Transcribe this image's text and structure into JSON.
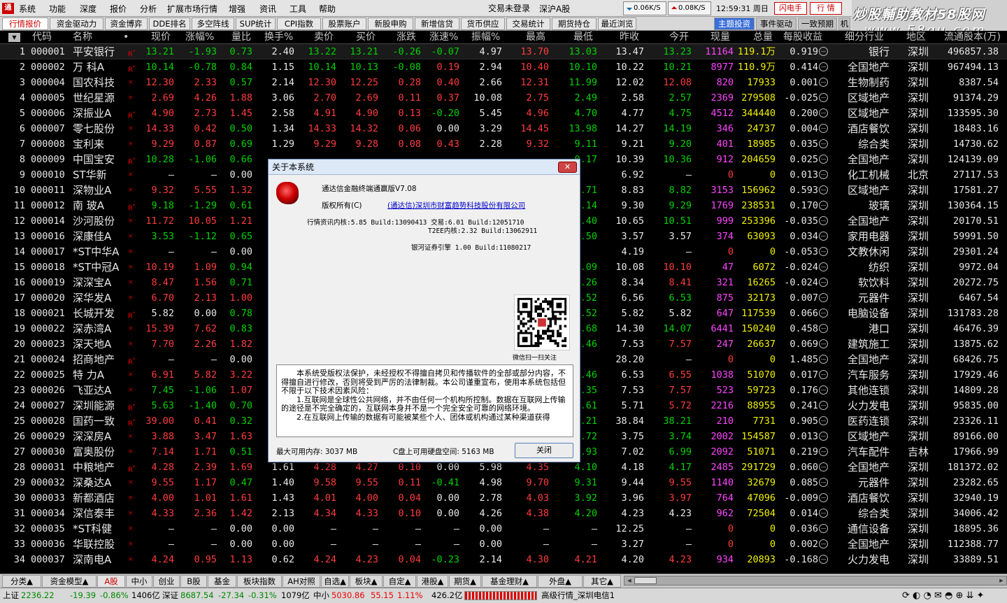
{
  "app": {
    "logo_label": "通",
    "menu": [
      "系统",
      "功能",
      "深度",
      "报价",
      "分析",
      "扩展市场行情",
      "增强",
      "资讯",
      "工具",
      "帮助"
    ],
    "status": {
      "login": "交易未登录",
      "market": "深沪A股"
    },
    "speed_down": "0.06K/S",
    "speed_up": "0.08K/S",
    "clock": "12:59:31 周日",
    "btn_flash": "闪电手",
    "btn_trade": "行 情",
    "watermark_line1": "炒股輔助教材58股网",
    "watermark_line2": "www.58gu.com"
  },
  "tabs": [
    "行情报价",
    "资金驱动力",
    "资金博弈",
    "DDE排名",
    "多空阵线",
    "SUP统计",
    "CPI指数",
    "股票账户",
    "新股申购",
    "新增信贷",
    "货币供应",
    "交易统计",
    "期货持仓",
    "最近浏览"
  ],
  "tabs_right": [
    "主题投资",
    "事件驱动",
    "一致预期",
    "机"
  ],
  "columns": [
    "代码",
    "名称",
    "•",
    "现价",
    "涨幅%",
    "量比",
    "换手%",
    "卖价",
    "买价",
    "涨跌",
    "涨速%",
    "振幅%",
    "最高",
    "最低",
    "昨收",
    "今开",
    "现量",
    "总量",
    "每股收益",
    "细分行业",
    "地区",
    "流通股本(万)"
  ],
  "rows": [
    {
      "n": "1",
      "code": "000001",
      "name": "平安银行",
      "mk": "R",
      "pr": "13.21",
      "chg": "-1.93",
      "vr": "0.73",
      "to": "2.40",
      "ask": "13.22",
      "bid": "13.21",
      "dif": "-0.26",
      "spd": "-0.07",
      "amp": "4.97",
      "hi": "13.70",
      "lo": "13.03",
      "pc": "13.47",
      "op": "13.23",
      "cv": "11164",
      "tv": "119.1万",
      "eps": "0.919",
      "ind": "银行",
      "reg": "深圳",
      "fl": "496857.38"
    },
    {
      "n": "2",
      "code": "000002",
      "name": "万 科A",
      "mk": "R",
      "pr": "10.14",
      "chg": "-0.78",
      "vr": "0.84",
      "to": "1.15",
      "ask": "10.14",
      "bid": "10.13",
      "dif": "-0.08",
      "spd": "0.19",
      "amp": "2.94",
      "hi": "10.40",
      "lo": "10.10",
      "pc": "10.22",
      "op": "10.21",
      "cv": "8977",
      "tv": "110.9万",
      "eps": "0.414",
      "ind": "全国地产",
      "reg": "深圳",
      "fl": "967494.13"
    },
    {
      "n": "3",
      "code": "000004",
      "name": "国农科技",
      "mk": "",
      "pr": "12.30",
      "chg": "2.33",
      "vr": "0.57",
      "to": "2.14",
      "ask": "12.30",
      "bid": "12.25",
      "dif": "0.28",
      "spd": "0.40",
      "amp": "2.66",
      "hi": "12.31",
      "lo": "11.99",
      "pc": "12.02",
      "op": "12.08",
      "cv": "820",
      "tv": "17933",
      "eps": "0.001",
      "ind": "生物制药",
      "reg": "深圳",
      "fl": "8387.54"
    },
    {
      "n": "4",
      "code": "000005",
      "name": "世纪星源",
      "mk": "",
      "pr": "2.69",
      "chg": "4.26",
      "vr": "1.88",
      "to": "3.06",
      "ask": "2.70",
      "bid": "2.69",
      "dif": "0.11",
      "spd": "0.37",
      "amp": "10.08",
      "hi": "2.75",
      "lo": "2.49",
      "pc": "2.58",
      "op": "2.57",
      "cv": "2369",
      "tv": "279508",
      "eps": "-0.025",
      "ind": "区域地产",
      "reg": "深圳",
      "fl": "91374.29"
    },
    {
      "n": "5",
      "code": "000006",
      "name": "深振业A",
      "mk": "R",
      "pr": "4.90",
      "chg": "2.73",
      "vr": "1.45",
      "to": "2.58",
      "ask": "4.91",
      "bid": "4.90",
      "dif": "0.13",
      "spd": "-0.20",
      "amp": "5.45",
      "hi": "4.96",
      "lo": "4.70",
      "pc": "4.77",
      "op": "4.75",
      "cv": "4512",
      "tv": "344440",
      "eps": "0.200",
      "ind": "区域地产",
      "reg": "深圳",
      "fl": "133595.30"
    },
    {
      "n": "6",
      "code": "000007",
      "name": "零七股份",
      "mk": "",
      "pr": "14.33",
      "chg": "0.42",
      "vr": "0.50",
      "to": "1.34",
      "ask": "14.33",
      "bid": "14.32",
      "dif": "0.06",
      "spd": "0.00",
      "amp": "3.29",
      "hi": "14.45",
      "lo": "13.98",
      "pc": "14.27",
      "op": "14.19",
      "cv": "346",
      "tv": "24737",
      "eps": "0.004",
      "ind": "酒店餐饮",
      "reg": "深圳",
      "fl": "18483.16"
    },
    {
      "n": "7",
      "code": "000008",
      "name": "宝利来",
      "mk": "",
      "pr": "9.29",
      "chg": "0.87",
      "vr": "0.69",
      "to": "1.29",
      "ask": "9.29",
      "bid": "9.28",
      "dif": "0.08",
      "spd": "0.43",
      "amp": "2.28",
      "hi": "9.32",
      "lo": "9.11",
      "pc": "9.21",
      "op": "9.20",
      "cv": "401",
      "tv": "18985",
      "eps": "0.035",
      "ind": "综合类",
      "reg": "深圳",
      "fl": "14730.62"
    },
    {
      "n": "8",
      "code": "000009",
      "name": "中国宝安",
      "mk": "R",
      "pr": "10.28",
      "chg": "-1.06",
      "vr": "0.66",
      "to": "",
      "ask": "",
      "bid": "",
      "dif": "",
      "spd": "",
      "amp": "",
      "hi": "",
      "lo": "0.17",
      "pc": "10.39",
      "op": "10.36",
      "cv": "912",
      "tv": "204659",
      "eps": "0.025",
      "ind": "全国地产",
      "reg": "深圳",
      "fl": "124139.09"
    },
    {
      "n": "9",
      "code": "000010",
      "name": "ST华新",
      "mk": "",
      "pr": "—",
      "chg": "—",
      "vr": "0.00",
      "to": "",
      "ask": "",
      "bid": "",
      "dif": "",
      "spd": "",
      "amp": "",
      "hi": "",
      "lo": "",
      "pc": "6.92",
      "op": "—",
      "cv": "0",
      "tv": "0",
      "eps": "0.013",
      "ind": "化工机械",
      "reg": "北京",
      "fl": "27117.53"
    },
    {
      "n": "10",
      "code": "000011",
      "name": "深物业A",
      "mk": "",
      "pr": "9.32",
      "chg": "5.55",
      "vr": "1.32",
      "to": "",
      "ask": "",
      "bid": "",
      "dif": "",
      "spd": "",
      "amp": "",
      "hi": "",
      "lo": ".71",
      "pc": "8.83",
      "op": "8.82",
      "cv": "3153",
      "tv": "156962",
      "eps": "0.593",
      "ind": "区域地产",
      "reg": "深圳",
      "fl": "17581.27"
    },
    {
      "n": "11",
      "code": "000012",
      "name": "南 玻A",
      "mk": "R",
      "pr": "9.18",
      "chg": "-1.29",
      "vr": "0.61",
      "to": "",
      "ask": "",
      "bid": "",
      "dif": "",
      "spd": "",
      "amp": "",
      "hi": "",
      "lo": ".14",
      "pc": "9.30",
      "op": "9.29",
      "cv": "1769",
      "tv": "238531",
      "eps": "0.170",
      "ind": "玻璃",
      "reg": "深圳",
      "fl": "130364.15"
    },
    {
      "n": "12",
      "code": "000014",
      "name": "沙河股份",
      "mk": "",
      "pr": "11.72",
      "chg": "10.05",
      "vr": "1.21",
      "to": "",
      "ask": "",
      "bid": "",
      "dif": "",
      "spd": "",
      "amp": "",
      "hi": "",
      "lo": ".40",
      "pc": "10.65",
      "op": "10.51",
      "cv": "999",
      "tv": "253396",
      "eps": "-0.035",
      "ind": "全国地产",
      "reg": "深圳",
      "fl": "20170.51"
    },
    {
      "n": "13",
      "code": "000016",
      "name": "深康佳A",
      "mk": "",
      "pr": "3.53",
      "chg": "-1.12",
      "vr": "0.65",
      "to": "",
      "ask": "",
      "bid": "",
      "dif": "",
      "spd": "",
      "amp": "",
      "hi": "",
      "lo": ".50",
      "pc": "3.57",
      "op": "3.57",
      "cv": "374",
      "tv": "63093",
      "eps": "0.034",
      "ind": "家用电器",
      "reg": "深圳",
      "fl": "59991.50"
    },
    {
      "n": "14",
      "code": "000017",
      "name": "*ST中华A",
      "mk": "",
      "pr": "—",
      "chg": "—",
      "vr": "0.00",
      "to": "",
      "ask": "",
      "bid": "",
      "dif": "",
      "spd": "",
      "amp": "",
      "hi": "",
      "lo": "",
      "pc": "4.19",
      "op": "—",
      "cv": "0",
      "tv": "0",
      "eps": "-0.053",
      "ind": "文教休闲",
      "reg": "深圳",
      "fl": "29301.24"
    },
    {
      "n": "15",
      "code": "000018",
      "name": "*ST中冠A",
      "mk": "",
      "pr": "10.19",
      "chg": "1.09",
      "vr": "0.94",
      "to": "",
      "ask": "",
      "bid": "",
      "dif": "",
      "spd": "",
      "amp": "",
      "hi": "",
      "lo": ".09",
      "pc": "10.08",
      "op": "10.10",
      "cv": "47",
      "tv": "6072",
      "eps": "-0.024",
      "ind": "纺织",
      "reg": "深圳",
      "fl": "9972.04"
    },
    {
      "n": "16",
      "code": "000019",
      "name": "深深宝A",
      "mk": "",
      "pr": "8.47",
      "chg": "1.56",
      "vr": "0.71",
      "to": "",
      "ask": "",
      "bid": "",
      "dif": "",
      "spd": "",
      "amp": "",
      "hi": "",
      "lo": ".26",
      "pc": "8.34",
      "op": "8.41",
      "cv": "321",
      "tv": "16265",
      "eps": "-0.024",
      "ind": "软饮料",
      "reg": "深圳",
      "fl": "20272.75"
    },
    {
      "n": "17",
      "code": "000020",
      "name": "深华发A",
      "mk": "",
      "pr": "6.70",
      "chg": "2.13",
      "vr": "1.00",
      "to": "",
      "ask": "",
      "bid": "",
      "dif": "",
      "spd": "",
      "amp": "",
      "hi": "",
      "lo": ".52",
      "pc": "6.56",
      "op": "6.53",
      "cv": "875",
      "tv": "32173",
      "eps": "0.007",
      "ind": "元器件",
      "reg": "深圳",
      "fl": "6467.54"
    },
    {
      "n": "18",
      "code": "000021",
      "name": "长城开发",
      "mk": "R",
      "pr": "5.82",
      "chg": "0.00",
      "vr": "0.78",
      "to": "",
      "ask": "",
      "bid": "",
      "dif": "",
      "spd": "",
      "amp": "",
      "hi": "",
      "lo": ".52",
      "pc": "5.82",
      "op": "5.82",
      "cv": "647",
      "tv": "117539",
      "eps": "0.066",
      "ind": "电脑设备",
      "reg": "深圳",
      "fl": "131783.28"
    },
    {
      "n": "19",
      "code": "000022",
      "name": "深赤湾A",
      "mk": "",
      "pr": "15.39",
      "chg": "7.62",
      "vr": "0.83",
      "to": "",
      "ask": "",
      "bid": "",
      "dif": "",
      "spd": "",
      "amp": "",
      "hi": "",
      "lo": ".68",
      "pc": "14.30",
      "op": "14.07",
      "cv": "6441",
      "tv": "150240",
      "eps": "0.458",
      "ind": "港口",
      "reg": "深圳",
      "fl": "46476.39"
    },
    {
      "n": "20",
      "code": "000023",
      "name": "深天地A",
      "mk": "",
      "pr": "7.70",
      "chg": "2.26",
      "vr": "1.82",
      "to": "",
      "ask": "",
      "bid": "",
      "dif": "",
      "spd": "",
      "amp": "",
      "hi": "",
      "lo": ".46",
      "pc": "7.53",
      "op": "7.57",
      "cv": "247",
      "tv": "26637",
      "eps": "0.069",
      "ind": "建筑施工",
      "reg": "深圳",
      "fl": "13875.62"
    },
    {
      "n": "21",
      "code": "000024",
      "name": "招商地产",
      "mk": "R",
      "pr": "—",
      "chg": "—",
      "vr": "0.00",
      "to": "",
      "ask": "",
      "bid": "",
      "dif": "",
      "spd": "",
      "amp": "",
      "hi": "",
      "lo": "",
      "pc": "28.20",
      "op": "—",
      "cv": "0",
      "tv": "0",
      "eps": "1.485",
      "ind": "全国地产",
      "reg": "深圳",
      "fl": "68426.75"
    },
    {
      "n": "22",
      "code": "000025",
      "name": "特 力A",
      "mk": "",
      "pr": "6.91",
      "chg": "5.82",
      "vr": "3.22",
      "to": "",
      "ask": "",
      "bid": "",
      "dif": "",
      "spd": "",
      "amp": "",
      "hi": "",
      "lo": ".46",
      "pc": "6.53",
      "op": "6.55",
      "cv": "1038",
      "tv": "51070",
      "eps": "0.017",
      "ind": "汽车服务",
      "reg": "深圳",
      "fl": "17929.46"
    },
    {
      "n": "23",
      "code": "000026",
      "name": "飞亚达A",
      "mk": "",
      "pr": "7.45",
      "chg": "-1.06",
      "vr": "1.07",
      "to": "",
      "ask": "",
      "bid": "",
      "dif": "",
      "spd": "",
      "amp": "",
      "hi": "",
      "lo": ".35",
      "pc": "7.53",
      "op": "7.57",
      "cv": "523",
      "tv": "59723",
      "eps": "0.176",
      "ind": "其他连锁",
      "reg": "深圳",
      "fl": "14809.28"
    },
    {
      "n": "24",
      "code": "000027",
      "name": "深圳能源",
      "mk": "R",
      "pr": "5.63",
      "chg": "-1.40",
      "vr": "0.70",
      "to": "",
      "ask": "",
      "bid": "",
      "dif": "",
      "spd": "",
      "amp": "",
      "hi": "",
      "lo": ".61",
      "pc": "5.71",
      "op": "5.72",
      "cv": "2216",
      "tv": "88955",
      "eps": "0.241",
      "ind": "火力发电",
      "reg": "深圳",
      "fl": "95835.00"
    },
    {
      "n": "25",
      "code": "000028",
      "name": "国药一致",
      "mk": "R",
      "pr": "39.00",
      "chg": "0.41",
      "vr": "0.32",
      "to": "",
      "ask": "",
      "bid": "",
      "dif": "",
      "spd": "",
      "amp": "",
      "hi": "",
      "lo": ".21",
      "pc": "38.84",
      "op": "38.21",
      "cv": "210",
      "tv": "7731",
      "eps": "0.905",
      "ind": "医药连锁",
      "reg": "深圳",
      "fl": "23326.11"
    },
    {
      "n": "26",
      "code": "000029",
      "name": "深深房A",
      "mk": "",
      "pr": "3.88",
      "chg": "3.47",
      "vr": "1.63",
      "to": "",
      "ask": "",
      "bid": "",
      "dif": "",
      "spd": "",
      "amp": "",
      "hi": "",
      "lo": ".72",
      "pc": "3.75",
      "op": "3.74",
      "cv": "2002",
      "tv": "154587",
      "eps": "0.013",
      "ind": "区域地产",
      "reg": "深圳",
      "fl": "89166.00"
    },
    {
      "n": "27",
      "code": "000030",
      "name": "富奥股份",
      "mk": "",
      "pr": "7.14",
      "chg": "1.71",
      "vr": "0.51",
      "to": "",
      "ask": "",
      "bid": "",
      "dif": "",
      "spd": "",
      "amp": "",
      "hi": "",
      "lo": ".93",
      "pc": "7.02",
      "op": "6.99",
      "cv": "2092",
      "tv": "51071",
      "eps": "0.219",
      "ind": "汽车配件",
      "reg": "吉林",
      "fl": "17966.99"
    },
    {
      "n": "28",
      "code": "000031",
      "name": "中粮地产",
      "mk": "R",
      "pr": "4.28",
      "chg": "2.39",
      "vr": "1.69",
      "to": "1.61",
      "ask": "4.28",
      "bid": "4.27",
      "dif": "0.10",
      "spd": "0.00",
      "amp": "5.98",
      "hi": "4.35",
      "lo": "4.10",
      "pc": "4.18",
      "op": "4.17",
      "cv": "2485",
      "tv": "291729",
      "eps": "0.060",
      "ind": "全国地产",
      "reg": "深圳",
      "fl": "181372.02"
    },
    {
      "n": "29",
      "code": "000032",
      "name": "深桑达A",
      "mk": "",
      "pr": "9.55",
      "chg": "1.17",
      "vr": "0.47",
      "to": "1.40",
      "ask": "9.58",
      "bid": "9.55",
      "dif": "0.11",
      "spd": "-0.41",
      "amp": "4.98",
      "hi": "9.70",
      "lo": "9.31",
      "pc": "9.44",
      "op": "9.55",
      "cv": "1140",
      "tv": "32679",
      "eps": "0.085",
      "ind": "元器件",
      "reg": "深圳",
      "fl": "23282.65"
    },
    {
      "n": "30",
      "code": "000033",
      "name": "新都酒店",
      "mk": "",
      "pr": "4.00",
      "chg": "1.01",
      "vr": "1.61",
      "to": "1.43",
      "ask": "4.01",
      "bid": "4.00",
      "dif": "0.04",
      "spd": "0.00",
      "amp": "2.78",
      "hi": "4.03",
      "lo": "3.92",
      "pc": "3.96",
      "op": "3.97",
      "cv": "764",
      "tv": "47096",
      "eps": "-0.009",
      "ind": "酒店餐饮",
      "reg": "深圳",
      "fl": "32940.19"
    },
    {
      "n": "31",
      "code": "000034",
      "name": "深信泰丰",
      "mk": "",
      "pr": "4.33",
      "chg": "2.36",
      "vr": "1.42",
      "to": "2.13",
      "ask": "4.34",
      "bid": "4.33",
      "dif": "0.10",
      "spd": "0.00",
      "amp": "4.26",
      "hi": "4.38",
      "lo": "4.20",
      "pc": "4.23",
      "op": "4.23",
      "cv": "962",
      "tv": "72504",
      "eps": "0.014",
      "ind": "综合类",
      "reg": "深圳",
      "fl": "34006.42"
    },
    {
      "n": "32",
      "code": "000035",
      "name": "*ST科健",
      "mk": "",
      "pr": "—",
      "chg": "—",
      "vr": "0.00",
      "to": "0.00",
      "ask": "—",
      "bid": "—",
      "dif": "—",
      "spd": "—",
      "amp": "0.00",
      "hi": "—",
      "lo": "—",
      "pc": "12.25",
      "op": "—",
      "cv": "0",
      "tv": "0",
      "eps": "0.036",
      "ind": "通信设备",
      "reg": "深圳",
      "fl": "18895.36"
    },
    {
      "n": "33",
      "code": "000036",
      "name": "华联控股",
      "mk": "",
      "pr": "—",
      "chg": "—",
      "vr": "0.00",
      "to": "0.00",
      "ask": "—",
      "bid": "—",
      "dif": "—",
      "spd": "—",
      "amp": "0.00",
      "hi": "—",
      "lo": "—",
      "pc": "3.27",
      "op": "—",
      "cv": "0",
      "tv": "0",
      "eps": "0.002",
      "ind": "全国地产",
      "reg": "深圳",
      "fl": "112388.77"
    },
    {
      "n": "34",
      "code": "000037",
      "name": "深南电A",
      "mk": "",
      "pr": "4.24",
      "chg": "0.95",
      "vr": "1.13",
      "to": "0.62",
      "ask": "4.24",
      "bid": "4.23",
      "dif": "0.04",
      "spd": "-0.23",
      "amp": "2.14",
      "hi": "4.30",
      "lo": "4.21",
      "pc": "4.20",
      "op": "4.23",
      "cv": "934",
      "tv": "20893",
      "eps": "-0.168",
      "ind": "火力发电",
      "reg": "深圳",
      "fl": "33889.51"
    }
  ],
  "bottom_tabs": [
    "分类▲",
    "资金模型▲",
    "A股",
    "中小",
    "创业",
    "B股",
    "基金",
    "板块指数",
    "AH对照",
    "自选▲",
    "板块▲",
    "自定▲",
    "港股▲",
    "期货▲",
    "基金理财▲",
    "外盘▲",
    "其它▲"
  ],
  "statusbar": {
    "sh_label": "上证",
    "sh_val": "2236.22",
    "sh_chg": "-19.39",
    "sh_pct": "-0.86%",
    "sh_amt": "1406亿",
    "sz_label": "深证",
    "sz_val": "8687.54",
    "sz_chg": "-27.34",
    "sz_pct": "-0.31%",
    "sz_amt": "1079亿",
    "zx_label": "中小",
    "zx_val": "5030.86",
    "zx_chg": "55.15",
    "zx_pct": "1.11%",
    "zx_amt": "426.2亿",
    "server": "高级行情_深圳电信1"
  },
  "dialog": {
    "title": "关于本系统",
    "close": "✕",
    "product": "通达信金融终端通赢版V7.08",
    "copyright": "版权所有(C)",
    "company": "(通达信)深圳市财富趋势科技股份有限公司",
    "ver1": "行情资讯内核:5.85 Build:13090413 交易:6.01 Build:12051710",
    "ver2": "T2EE内核:2.32 Build:13062911",
    "ver3": "银河证券引擎 1.00 Build:11080217",
    "qr_caption": "微信扫一扫关注",
    "notice_p1": "本系统受版权法保护，未经授权不得擅自拷贝和传播软件的全部或部分内容，不得擅自进行修改，否则将受到严厉的法律制裁。本公司谨重宣布，使用本系统包括但不限于以下技术因素风险：",
    "notice_p2": "1.互联网是全球性公共网络，并不由任何一个机构所控制。数据在互联网上传输的途径是不完全确定的，互联网本身并不是一个完全安全可靠的网络环境。",
    "notice_p3": "2.在互联网上传输的数据有可能被某些个人、团体或机构通过某种渠道获得",
    "mem_label": "最大可用内存: 3037 MB",
    "disk_label": "C盘上可用硬盘空间: 5163 MB",
    "ok": "关闭"
  },
  "colors": {
    "up": "#ff3c3c",
    "down": "#00d200",
    "flat": "#e8e8e8",
    "volume": "#f0f000",
    "curvol": "#ff45ff"
  }
}
